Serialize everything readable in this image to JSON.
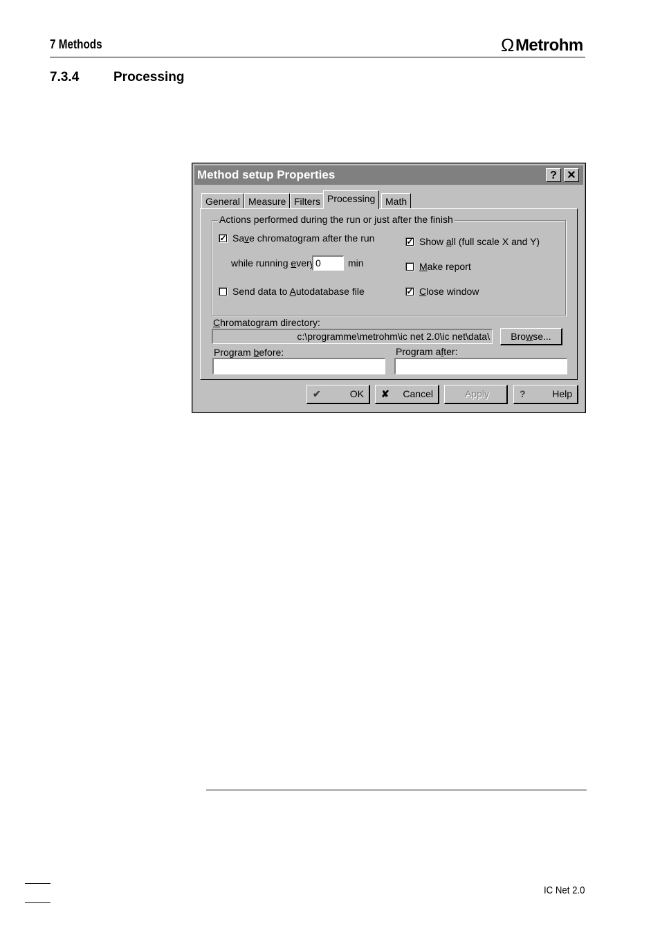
{
  "header": {
    "chapter": "7  Methods",
    "logo_text": "Metrohm",
    "logo_symbol": "Ω"
  },
  "section": {
    "number": "7.3.4",
    "title": "Processing"
  },
  "dialog": {
    "title": "Method setup Properties",
    "help_glyph": "?",
    "close_glyph": "✕",
    "tabs": [
      "General",
      "Measure",
      "Filters",
      "Processing",
      "Math"
    ],
    "selected_tab": "Processing",
    "group_title": "Actions performed during the run or just after the finish",
    "options": {
      "save_chromatogram": {
        "pre": "Sa",
        "key": "v",
        "post": "e chromatogram after the run",
        "checked": true
      },
      "while_running_pre": "while running ",
      "while_running_key": "e",
      "while_running_post": "very",
      "interval_value": "0",
      "interval_unit": "min",
      "send_autodatabase": {
        "pre": "Send data to ",
        "key": "A",
        "post": "utodatabase file",
        "checked": false
      },
      "show_all": {
        "pre": "Show ",
        "key": "a",
        "post": "ll (full scale X and Y)",
        "checked": true
      },
      "make_report": {
        "pre": "",
        "key": "M",
        "post": "ake report",
        "checked": false
      },
      "close_window": {
        "pre": "",
        "key": "C",
        "post": "lose window",
        "checked": true
      }
    },
    "directory": {
      "label_key": "C",
      "label_rest": "hromatogram directory:",
      "value": "c:\\programme\\metrohm\\ic net 2.0\\ic net\\data\\",
      "browse_pre": "Bro",
      "browse_key": "w",
      "browse_post": "se..."
    },
    "program_before": {
      "label_pre": "Program ",
      "label_key": "b",
      "label_post": "efore:",
      "value": ""
    },
    "program_after": {
      "label_pre": "Program a",
      "label_key": "f",
      "label_post": "ter:",
      "value": ""
    },
    "buttons": {
      "ok": "OK",
      "ok_icon": "✔",
      "cancel": "Cancel",
      "cancel_icon": "✘",
      "apply": "Apply",
      "help": "Help",
      "help_icon": "?"
    },
    "check_glyph": "✓"
  },
  "footer": {
    "product": "IC Net 2.0"
  }
}
